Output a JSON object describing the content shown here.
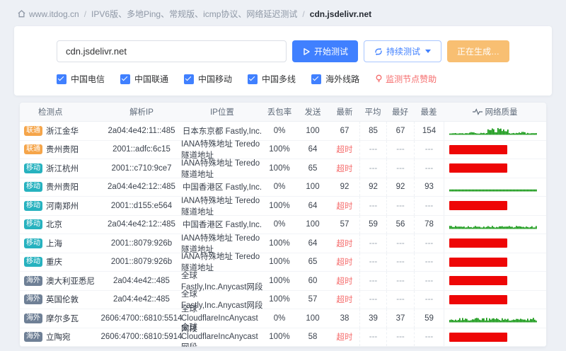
{
  "breadcrumb": {
    "site": "www.itdog.cn",
    "separator": "/",
    "path": "IPV6版、多地Ping、常规版、icmp协议、网络延迟测试",
    "target": "cdn.jsdelivr.net"
  },
  "toolbar": {
    "input_value": "cdn.jsdelivr.net",
    "start_button": "开始测试",
    "continuous_button": "持续测试",
    "generating_button": "正在生成…",
    "checkboxes": [
      {
        "key": "china-telecom",
        "label": "中国电信",
        "checked": true
      },
      {
        "key": "china-unicom",
        "label": "中国联通",
        "checked": true
      },
      {
        "key": "china-mobile",
        "label": "中国移动",
        "checked": true
      },
      {
        "key": "china-multiline",
        "label": "中国多线",
        "checked": true
      },
      {
        "key": "overseas",
        "label": "海外线路",
        "checked": true
      }
    ],
    "sponsor_link": "监测节点赞助"
  },
  "badge_colors": {
    "联通": "#f5a54a",
    "移动": "#27b2bf",
    "海外": "#6f8096"
  },
  "colors": {
    "accent_blue": "#4080ff",
    "warning_orange": "#f8bf72",
    "timeout_red": "#f56c6c",
    "bar_red": "#ee0606",
    "spark_green": "#119611",
    "page_bg": "#edf0f5"
  },
  "table": {
    "headers": [
      "检测点",
      "解析IP",
      "IP位置",
      "丢包率",
      "发送",
      "最新",
      "平均",
      "最好",
      "最差",
      "网络质量"
    ],
    "header_keys": [
      "node",
      "ip",
      "location",
      "loss",
      "sent",
      "latest",
      "avg",
      "best",
      "worst",
      "quality"
    ],
    "timeout_label": "超时",
    "dash_label": "---",
    "rows": [
      {
        "carrier": "联通",
        "node": "浙江金华",
        "ip": "2a04:4e42:11::485",
        "location": "日本东京都 Fastly,Inc.",
        "loss": "0%",
        "sent": "100",
        "latest": "67",
        "avg": "85",
        "best": "67",
        "worst": "154",
        "timeout": false,
        "quality": "spiky"
      },
      {
        "carrier": "联通",
        "node": "贵州贵阳",
        "ip": "2001::adfc:6c15",
        "location": "IANA特殊地址 Teredo隧道地址",
        "loss": "100%",
        "sent": "64",
        "latest": "超时",
        "avg": "---",
        "best": "---",
        "worst": "---",
        "timeout": true,
        "quality": "timeout"
      },
      {
        "carrier": "移动",
        "node": "浙江杭州",
        "ip": "2001::c710:9ce7",
        "location": "IANA特殊地址 Teredo隧道地址",
        "loss": "100%",
        "sent": "65",
        "latest": "超时",
        "avg": "---",
        "best": "---",
        "worst": "---",
        "timeout": true,
        "quality": "timeout"
      },
      {
        "carrier": "移动",
        "node": "贵州贵阳",
        "ip": "2a04:4e42:12::485",
        "location": "中国香港区 Fastly,Inc.",
        "loss": "0%",
        "sent": "100",
        "latest": "92",
        "avg": "92",
        "best": "92",
        "worst": "93",
        "timeout": false,
        "quality": "flat"
      },
      {
        "carrier": "移动",
        "node": "河南郑州",
        "ip": "2001::d155:e564",
        "location": "IANA特殊地址 Teredo隧道地址",
        "loss": "100%",
        "sent": "64",
        "latest": "超时",
        "avg": "---",
        "best": "---",
        "worst": "---",
        "timeout": true,
        "quality": "timeout"
      },
      {
        "carrier": "移动",
        "node": "北京",
        "ip": "2a04:4e42:12::485",
        "location": "中国香港区 Fastly,Inc.",
        "loss": "0%",
        "sent": "100",
        "latest": "57",
        "avg": "59",
        "best": "56",
        "worst": "78",
        "timeout": false,
        "quality": "lownoise"
      },
      {
        "carrier": "移动",
        "node": "上海",
        "ip": "2001::8079:926b",
        "location": "IANA特殊地址 Teredo隧道地址",
        "loss": "100%",
        "sent": "64",
        "latest": "超时",
        "avg": "---",
        "best": "---",
        "worst": "---",
        "timeout": true,
        "quality": "timeout"
      },
      {
        "carrier": "移动",
        "node": "重庆",
        "ip": "2001::8079:926b",
        "location": "IANA特殊地址 Teredo隧道地址",
        "loss": "100%",
        "sent": "65",
        "latest": "超时",
        "avg": "---",
        "best": "---",
        "worst": "---",
        "timeout": true,
        "quality": "timeout"
      },
      {
        "carrier": "海外",
        "node": "澳大利亚悉尼",
        "ip": "2a04:4e42::485",
        "location": "全球 Fastly,Inc.Anycast网段",
        "loss": "100%",
        "sent": "60",
        "latest": "超时",
        "avg": "---",
        "best": "---",
        "worst": "---",
        "timeout": true,
        "quality": "timeout"
      },
      {
        "carrier": "海外",
        "node": "英国伦敦",
        "ip": "2a04:4e42::485",
        "location": "全球 Fastly,Inc.Anycast网段",
        "loss": "100%",
        "sent": "57",
        "latest": "超时",
        "avg": "---",
        "best": "---",
        "worst": "---",
        "timeout": true,
        "quality": "timeout"
      },
      {
        "carrier": "海外",
        "node": "摩尔多瓦",
        "ip": "2606:4700::6810:5514",
        "location": "全球 CloudflareIncAnycast网段",
        "loss": "0%",
        "sent": "100",
        "latest": "38",
        "avg": "39",
        "best": "37",
        "worst": "59",
        "timeout": false,
        "quality": "noisy"
      },
      {
        "carrier": "海外",
        "node": "立陶宛",
        "ip": "2606:4700::6810:5914",
        "location": "全球 CloudflareIncAnycast网段",
        "loss": "100%",
        "sent": "58",
        "latest": "超时",
        "avg": "---",
        "best": "---",
        "worst": "---",
        "timeout": true,
        "quality": "timeout"
      }
    ]
  }
}
